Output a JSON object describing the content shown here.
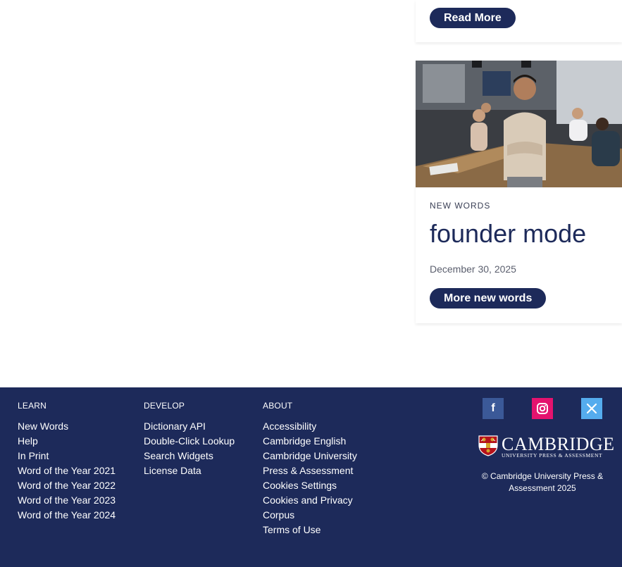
{
  "top_card": {
    "button_label": "Read More"
  },
  "card": {
    "category": "NEW WORDS",
    "title": "founder mode",
    "date": "December 30, 2025",
    "button_label": "More new words",
    "image_icon": "office-meeting-photo"
  },
  "footer": {
    "learn": {
      "heading": "LEARN",
      "links": [
        "New Words",
        "Help",
        "In Print",
        "Word of the Year 2021",
        "Word of the Year 2022",
        "Word of the Year 2023",
        "Word of the Year 2024"
      ]
    },
    "develop": {
      "heading": "DEVELOP",
      "links": [
        "Dictionary API",
        "Double-Click Lookup",
        "Search Widgets",
        "License Data"
      ]
    },
    "about": {
      "heading": "ABOUT",
      "links": [
        "Accessibility",
        "Cambridge English",
        "Cambridge University",
        "Press & Assessment",
        "Cookies Settings",
        "Cookies and Privacy",
        "Corpus",
        "Terms of Use"
      ]
    },
    "social": {
      "facebook": "f",
      "instagram_icon": "instagram-icon",
      "x_icon": "x-icon"
    },
    "logo": {
      "title": "CAMBRIDGE",
      "subtitle": "UNIVERSITY PRESS & ASSESSMENT"
    },
    "copyright": "© Cambridge University Press & Assessment 2025"
  },
  "colors": {
    "navy": "#1d2a5a",
    "facebook": "#3b5998",
    "instagram": "#e4136e",
    "twitter": "#55acee"
  }
}
